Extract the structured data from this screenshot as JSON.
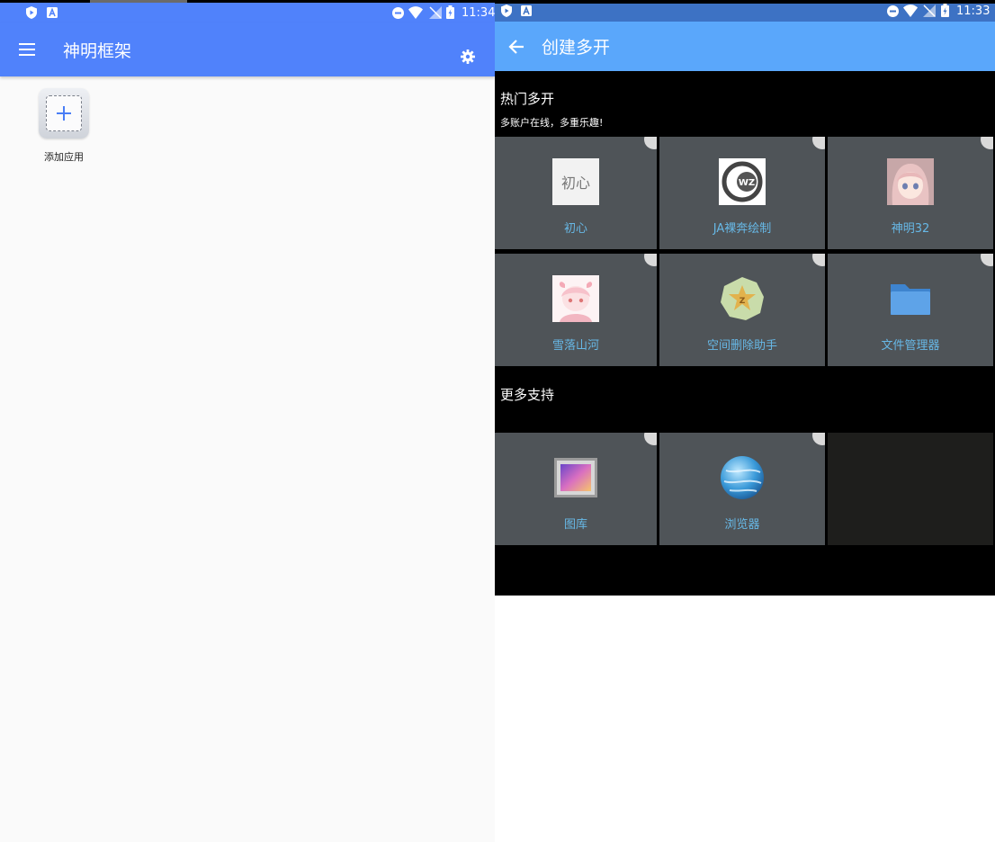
{
  "left": {
    "status_time": "11:34",
    "app_title": "神明框架",
    "add_app_label": "添加应用",
    "colors": {
      "primary": "#5082fb",
      "background": "#fafafa"
    }
  },
  "right": {
    "status_time": "11:33",
    "page_title": "创建多开",
    "hot_section_title": "热门多开",
    "hot_section_subtitle": "多账户在线，多重乐趣!",
    "hot_apps": [
      {
        "name": "初心",
        "icon": "chuxin-calligraphy-icon"
      },
      {
        "name": "JA裸奔绘制",
        "icon": "wz-logo-icon"
      },
      {
        "name": "神明32",
        "icon": "anime-girl-avatar-icon"
      },
      {
        "name": "雪落山河",
        "icon": "pink-anime-avatar-icon"
      },
      {
        "name": "空间删除助手",
        "icon": "qzone-star-icon"
      },
      {
        "name": "文件管理器",
        "icon": "folder-icon"
      }
    ],
    "more_section_title": "更多支持",
    "more_apps": [
      {
        "name": "图库",
        "icon": "gallery-icon"
      },
      {
        "name": "浏览器",
        "icon": "globe-icon"
      }
    ],
    "colors": {
      "appbar": "#5aa7fb",
      "statusbar": "#3d72c4",
      "tile": "#4f5458",
      "label": "#67b8e6"
    }
  }
}
